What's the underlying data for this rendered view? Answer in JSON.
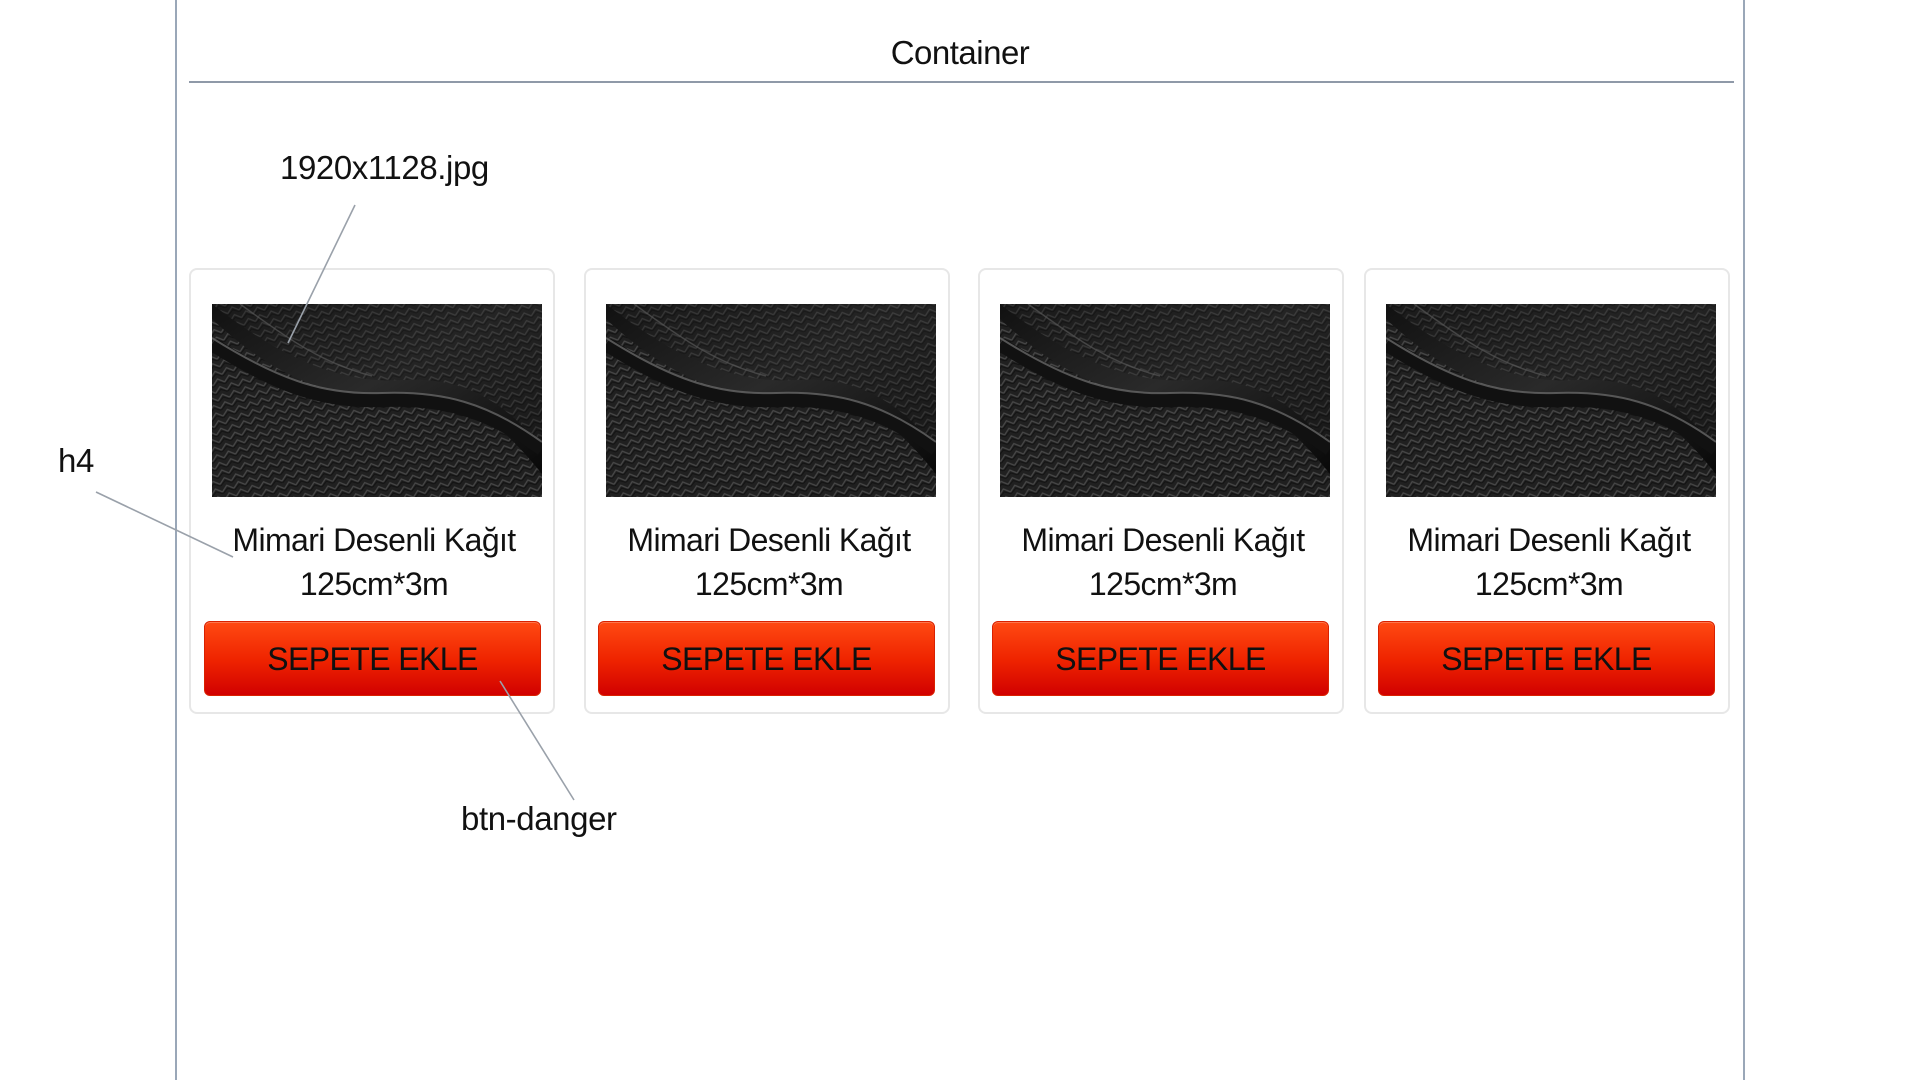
{
  "container": {
    "label": "Container"
  },
  "annotations": {
    "image_file": "1920x1128.jpg",
    "heading_tag": "h4",
    "button_class": "btn-danger"
  },
  "products": [
    {
      "title_line_1": "Mimari Desenli Kağıt",
      "title_line_2": "125cm*3m",
      "button_label": "SEPETE EKLE"
    },
    {
      "title_line_1": "Mimari Desenli Kağıt",
      "title_line_2": "125cm*3m",
      "button_label": "SEPETE EKLE"
    },
    {
      "title_line_1": "Mimari Desenli Kağıt",
      "title_line_2": "125cm*3m",
      "button_label": "SEPETE EKLE"
    },
    {
      "title_line_1": "Mimari Desenli Kağıt",
      "title_line_2": "125cm*3m",
      "button_label": "SEPETE EKLE"
    }
  ],
  "colors": {
    "button_red": "#ef2400",
    "frame_line": "#8f99a8"
  }
}
